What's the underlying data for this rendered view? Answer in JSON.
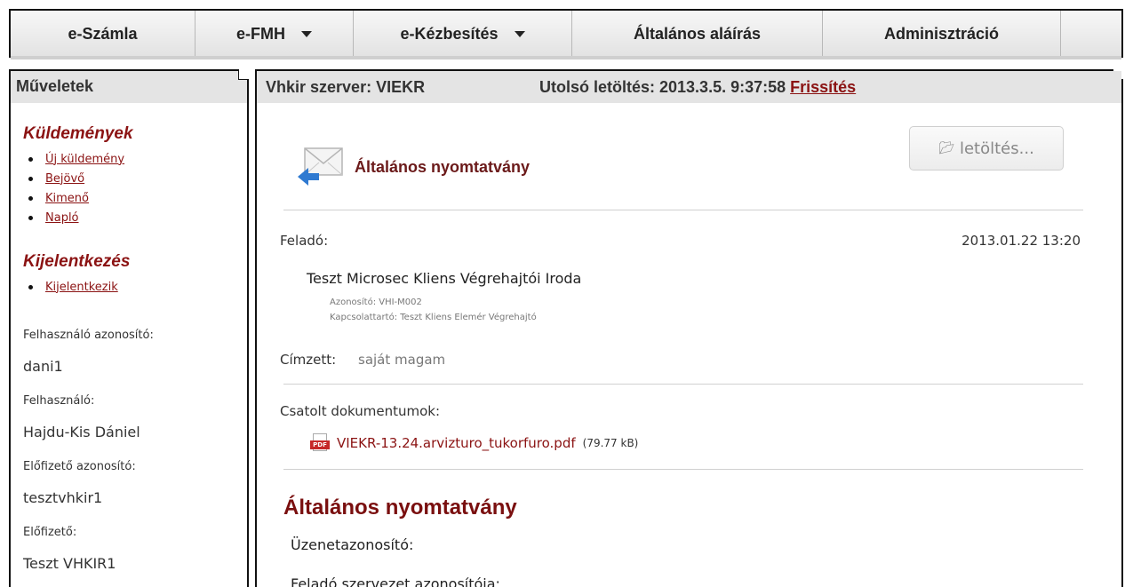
{
  "nav": {
    "items": [
      {
        "label": "e-Számla",
        "dropdown": false
      },
      {
        "label": "e-FMH",
        "dropdown": true
      },
      {
        "label": "e-Kézbesítés",
        "dropdown": true
      },
      {
        "label": "Általános aláírás",
        "dropdown": false
      },
      {
        "label": "Adminisztráció",
        "dropdown": false
      }
    ]
  },
  "sidebar": {
    "title": "Műveletek",
    "sections": [
      {
        "title": "Küldemények",
        "links": [
          "Új küldemény",
          "Bejövő",
          "Kimenő",
          "Napló"
        ]
      },
      {
        "title": "Kijelentkezés",
        "links": [
          "Kijelentkezik"
        ]
      }
    ],
    "info": [
      {
        "label": "Felhasználó azonosító:",
        "value": "dani1"
      },
      {
        "label": "Felhasználó:",
        "value": "Hajdu-Kis Dániel"
      },
      {
        "label": "Előfizető azonosító:",
        "value": "tesztvhkir1"
      },
      {
        "label": "Előfizető:",
        "value": "Teszt VHKIR1"
      }
    ]
  },
  "main": {
    "server": "Vhkir szerver: VIEKR",
    "last_download": "Utolsó letöltés: 2013.3.5. 9:37:58",
    "refresh": "Frissítés",
    "doc_title": "Általános nyomtatvány",
    "download_button": "letöltés...",
    "sender_label": "Feladó:",
    "date": "2013.01.22 13:20",
    "sender_name": "Teszt Microsec Kliens Végrehajtói Iroda",
    "sender_id": "Azonosító: VHI-M002",
    "sender_contact": "Kapcsolattartó: Teszt Kliens Elemér Végrehajtó",
    "recipient_label": "Címzett:",
    "recipient_value": "saját magam",
    "attachments_label": "Csatolt dokumentumok:",
    "attachment_name": "VIEKR-13.24.arvizturo_tukorfuro.pdf",
    "attachment_size": "(79.77 kB)",
    "form_title": "Általános nyomtatvány",
    "fields": [
      "Üzenetazonosító:",
      "Feladó szervezet azonosítója:"
    ]
  },
  "icons": {
    "envelope": "envelope-incoming-icon",
    "pdf": "pdf-file-icon",
    "folder": "folder-open-icon",
    "caret": "caret-down-icon"
  }
}
